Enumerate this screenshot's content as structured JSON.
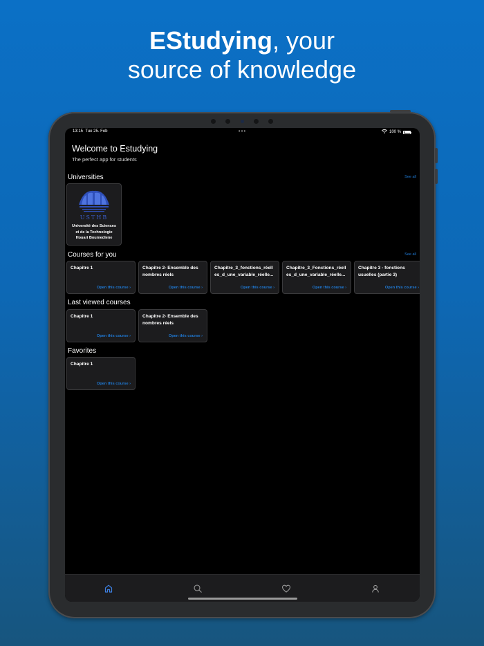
{
  "promo": {
    "headline_brand": "EStudying",
    "headline_rest": ", your",
    "headline_line2": "source of knowledge"
  },
  "status_bar": {
    "time": "13:15",
    "date": "Tue 25. Feb",
    "battery": "100 %"
  },
  "welcome": {
    "title": "Welcome to Estudying",
    "subtitle": "The perfect app for students"
  },
  "universities": {
    "title": "Universities",
    "see_all": "See all",
    "items": [
      {
        "logo_text": "USTHB",
        "name_line1": "Université des Sciences",
        "name_line2": "et de la Technologie",
        "name_line3": "Houari Boumediene"
      }
    ]
  },
  "courses_for_you": {
    "title": "Courses for you",
    "see_all": "See all",
    "items": [
      {
        "title": "Chapitre 1",
        "action": "Open this course ›"
      },
      {
        "title": "Chapitre 2- Ensemble des nombres réels",
        "action": "Open this course ›"
      },
      {
        "title": "Chapitre_3_fonctions_réelles_d_une_variable_réelle...",
        "action": "Open this course ›"
      },
      {
        "title": "Chapitre_3_Fonctions_réelles_d_une_variable_réelle...",
        "action": "Open this course ›"
      },
      {
        "title": "Chapitre 3 - fonctions usuelles (partie 3)",
        "action": "Open this course ›"
      }
    ]
  },
  "last_viewed": {
    "title": "Last viewed courses",
    "items": [
      {
        "title": "Chapitre 1",
        "action": "Open this course ›"
      },
      {
        "title": "Chapitre 2- Ensemble des nombres réels",
        "action": "Open this course ›"
      }
    ]
  },
  "favorites": {
    "title": "Favorites",
    "items": [
      {
        "title": "Chapitre 1",
        "action": "Open this course ›"
      }
    ]
  },
  "tabbar": {
    "tabs": [
      {
        "icon": "home-icon",
        "active": true
      },
      {
        "icon": "search-icon",
        "active": false
      },
      {
        "icon": "heart-icon",
        "active": false
      },
      {
        "icon": "person-icon",
        "active": false
      }
    ]
  },
  "colors": {
    "accent": "#1f7ad6",
    "background_top": "#0b70c6",
    "background_bottom": "#17557e",
    "card": "#1c1c1e"
  }
}
